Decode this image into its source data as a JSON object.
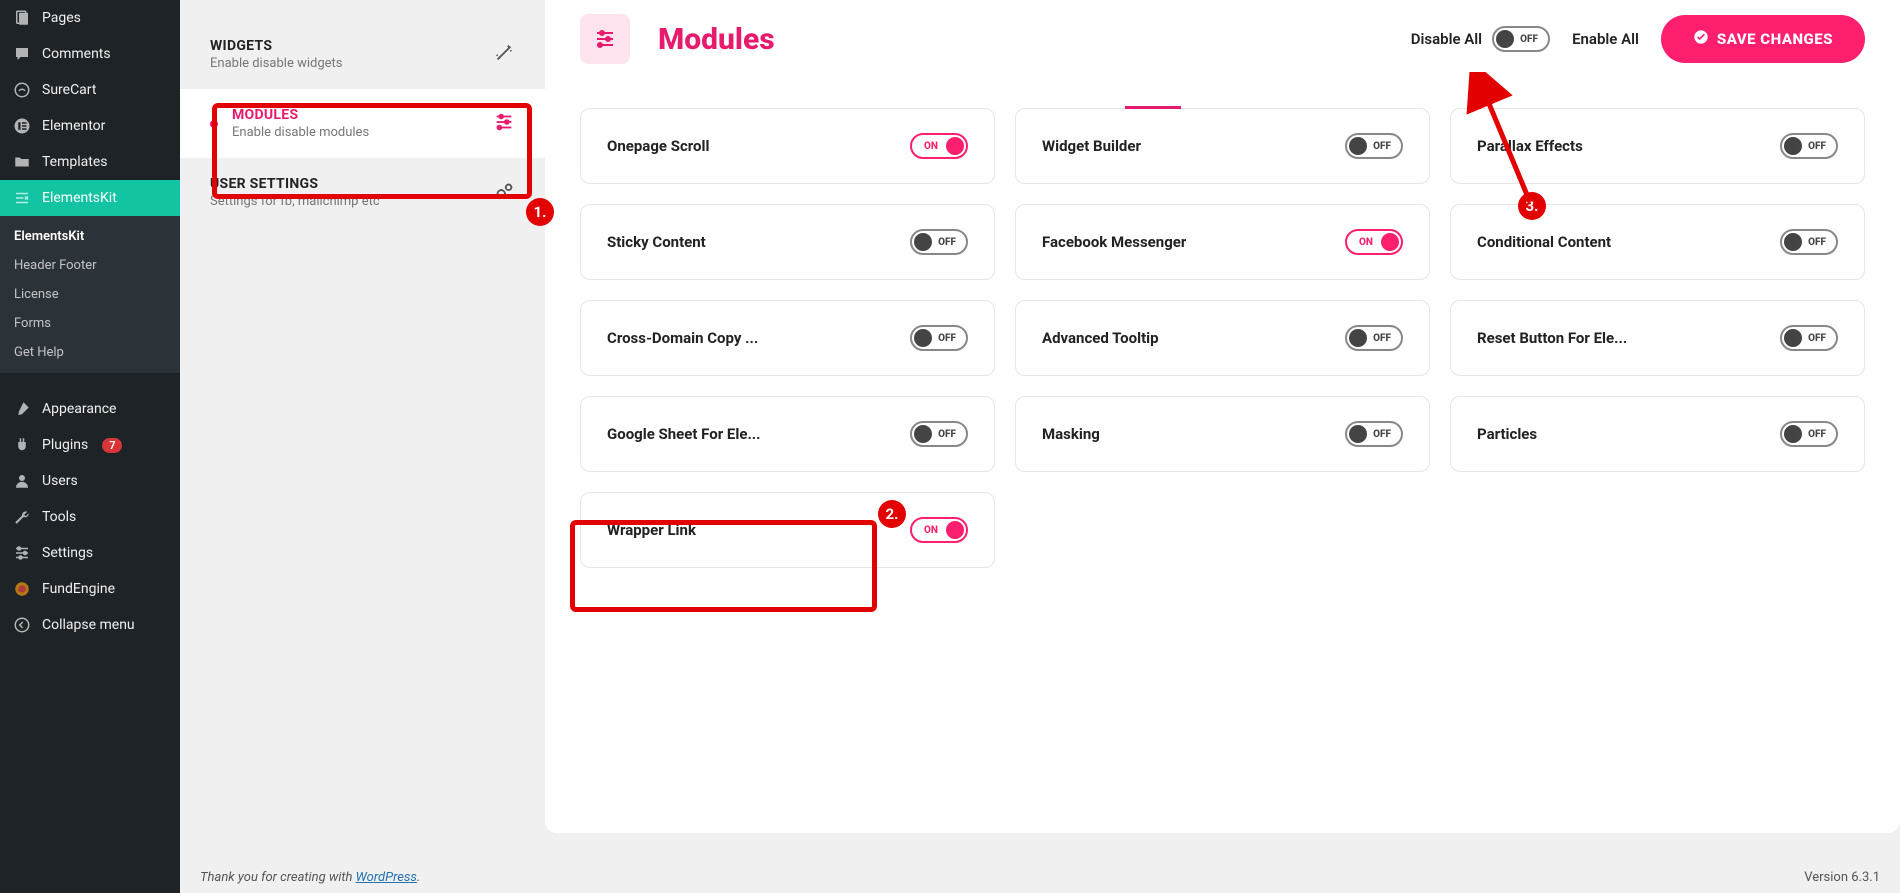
{
  "sidebar": {
    "items": [
      {
        "label": "Pages",
        "icon": "pages"
      },
      {
        "label": "Comments",
        "icon": "comment"
      },
      {
        "label": "SureCart",
        "icon": "surecart"
      },
      {
        "label": "Elementor",
        "icon": "elementor"
      },
      {
        "label": "Templates",
        "icon": "folder"
      },
      {
        "label": "ElementsKit",
        "icon": "ek",
        "active": true
      },
      {
        "label": "Appearance",
        "icon": "brush"
      },
      {
        "label": "Plugins",
        "icon": "plugin",
        "badge": "7"
      },
      {
        "label": "Users",
        "icon": "user"
      },
      {
        "label": "Tools",
        "icon": "wrench"
      },
      {
        "label": "Settings",
        "icon": "settings"
      },
      {
        "label": "FundEngine",
        "icon": "fund"
      },
      {
        "label": "Collapse menu",
        "icon": "collapse"
      }
    ],
    "subitems": [
      {
        "label": "ElementsKit",
        "current": true
      },
      {
        "label": "Header Footer"
      },
      {
        "label": "License"
      },
      {
        "label": "Forms"
      },
      {
        "label": "Get Help"
      }
    ]
  },
  "settingsTabs": [
    {
      "title": "WIDGETS",
      "sub": "Enable disable widgets",
      "icon": "magic"
    },
    {
      "title": "MODULES",
      "sub": "Enable disable modules",
      "icon": "sliders",
      "active": true
    },
    {
      "title": "USER SETTINGS",
      "sub": "Settings for fb, mailchimp etc",
      "icon": "gears"
    }
  ],
  "panel": {
    "title": "Modules",
    "disableAll": "Disable All",
    "enableAll": "Enable All",
    "save": "SAVE CHANGES"
  },
  "modules": [
    {
      "name": "Onepage Scroll",
      "on": true
    },
    {
      "name": "Widget Builder",
      "on": false
    },
    {
      "name": "Parallax Effects",
      "on": false
    },
    {
      "name": "Sticky Content",
      "on": false
    },
    {
      "name": "Facebook Messenger",
      "on": true
    },
    {
      "name": "Conditional Content",
      "on": false
    },
    {
      "name": "Cross-Domain Copy ...",
      "on": false
    },
    {
      "name": "Advanced Tooltip",
      "on": false
    },
    {
      "name": "Reset Button For Ele...",
      "on": false
    },
    {
      "name": "Google Sheet For Ele...",
      "on": false
    },
    {
      "name": "Masking",
      "on": false
    },
    {
      "name": "Particles",
      "on": false
    },
    {
      "name": "Wrapper Link",
      "on": true
    }
  ],
  "toggleLabels": {
    "on": "ON",
    "off": "OFF"
  },
  "annotations": {
    "n1": "1.",
    "n2": "2.",
    "n3": "3."
  },
  "footer": {
    "thanks_pre": "Thank you for creating with ",
    "wp": "WordPress",
    "thanks_post": ".",
    "version": "Version 6.3.1"
  }
}
